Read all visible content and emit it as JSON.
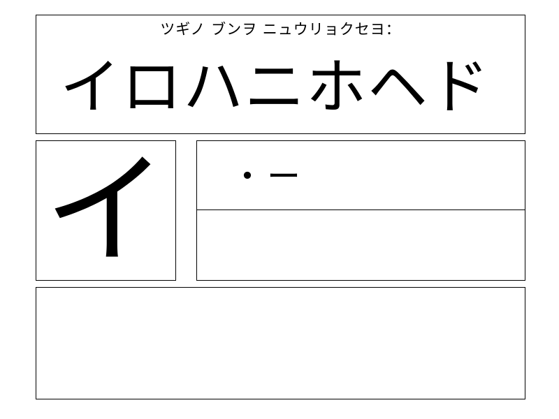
{
  "prompt": {
    "instruction": "ツギノ ブンヲ ニュウリョクセヨ：",
    "target_text": "イロハニホヘド"
  },
  "current": {
    "character": "イ",
    "morse_code": "・ー"
  },
  "input": {
    "morse_entered": ""
  },
  "output": {
    "typed_text": ""
  }
}
